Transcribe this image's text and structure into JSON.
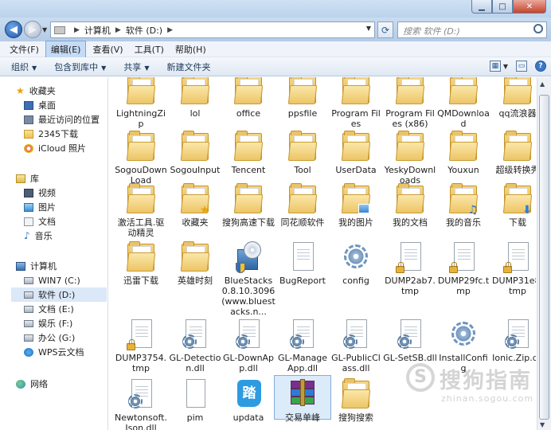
{
  "address": {
    "path": [
      "计算机",
      "软件 (D:)"
    ],
    "search_placeholder": "搜索 软件 (D:)"
  },
  "menu": [
    "文件(F)",
    "编辑(E)",
    "查看(V)",
    "工具(T)",
    "帮助(H)"
  ],
  "toolbar": [
    "组织",
    "包含到库中",
    "共享",
    "新建文件夹"
  ],
  "nav": {
    "favorites_label": "收藏夹",
    "favorites": [
      "桌面",
      "最近访问的位置",
      "2345下载",
      "iCloud 照片"
    ],
    "libraries_label": "库",
    "libraries": [
      "视频",
      "图片",
      "文档",
      "音乐"
    ],
    "computer_label": "计算机",
    "drives": [
      "WIN7 (C:)",
      "软件 (D:)",
      "文档 (E:)",
      "娱乐 (F:)",
      "办公 (G:)",
      "WPS云文档"
    ],
    "network_label": "网络"
  },
  "files": [
    {
      "name": "LightningZip",
      "kind": "folder"
    },
    {
      "name": "lol",
      "kind": "folder"
    },
    {
      "name": "office",
      "kind": "folder"
    },
    {
      "name": "ppsfile",
      "kind": "folder"
    },
    {
      "name": "Program Files",
      "kind": "folder"
    },
    {
      "name": "Program Files (x86)",
      "kind": "folder"
    },
    {
      "name": "QMDownload",
      "kind": "folder"
    },
    {
      "name": "qq流浪器",
      "kind": "folder"
    },
    {
      "name": "SogouDownLoad",
      "kind": "folder"
    },
    {
      "name": "SogouInput",
      "kind": "folder"
    },
    {
      "name": "Tencent",
      "kind": "folder"
    },
    {
      "name": "Tool",
      "kind": "folder"
    },
    {
      "name": "UserData",
      "kind": "folder"
    },
    {
      "name": "YeskyDownloads",
      "kind": "folder"
    },
    {
      "name": "Youxun",
      "kind": "folder"
    },
    {
      "name": "超级转换秀",
      "kind": "folder"
    },
    {
      "name": "激活工具.驱动精灵",
      "kind": "folder"
    },
    {
      "name": "收藏夹",
      "kind": "folder",
      "badge": "star"
    },
    {
      "name": "搜狗高速下载",
      "kind": "folder"
    },
    {
      "name": "同花顺软件",
      "kind": "folder"
    },
    {
      "name": "我的图片",
      "kind": "folder",
      "badge": "photo"
    },
    {
      "name": "我的文档",
      "kind": "folder"
    },
    {
      "name": "我的音乐",
      "kind": "folder",
      "badge": "note"
    },
    {
      "name": "下载",
      "kind": "folder",
      "badge": "arrow"
    },
    {
      "name": "迅雷下载",
      "kind": "folder"
    },
    {
      "name": "英雄时刻",
      "kind": "folder"
    },
    {
      "name": "BlueStacks0.8.10.3096(www.bluestacks.n...",
      "kind": "installer"
    },
    {
      "name": "BugReport",
      "kind": "page"
    },
    {
      "name": "config",
      "kind": "gear"
    },
    {
      "name": "DUMP2ab7.tmp",
      "kind": "lock"
    },
    {
      "name": "DUMP29fc.tmp",
      "kind": "lock"
    },
    {
      "name": "DUMP31e8.tmp",
      "kind": "lock"
    },
    {
      "name": "DUMP3754.tmp",
      "kind": "lock"
    },
    {
      "name": "GL-Detection.dll",
      "kind": "dll"
    },
    {
      "name": "GL-DownApp.dll",
      "kind": "dll"
    },
    {
      "name": "GL-ManageApp.dll",
      "kind": "dll"
    },
    {
      "name": "GL-PublicClass.dll",
      "kind": "dll"
    },
    {
      "name": "GL-SetSB.dll",
      "kind": "dll"
    },
    {
      "name": "InstallConfig",
      "kind": "gear"
    },
    {
      "name": "Ionic.Zip.dll",
      "kind": "dll"
    },
    {
      "name": "Newtonsoft.Json.dll",
      "kind": "dll"
    },
    {
      "name": "pim",
      "kind": "pim"
    },
    {
      "name": "updata",
      "kind": "updata"
    },
    {
      "name": "交易单峰",
      "kind": "rar",
      "selected": true
    },
    {
      "name": "搜狗搜索",
      "kind": "folder"
    }
  ],
  "watermark": {
    "text": "搜狗指南",
    "domain": "zhinan.sogou.com",
    "mark": "S"
  }
}
